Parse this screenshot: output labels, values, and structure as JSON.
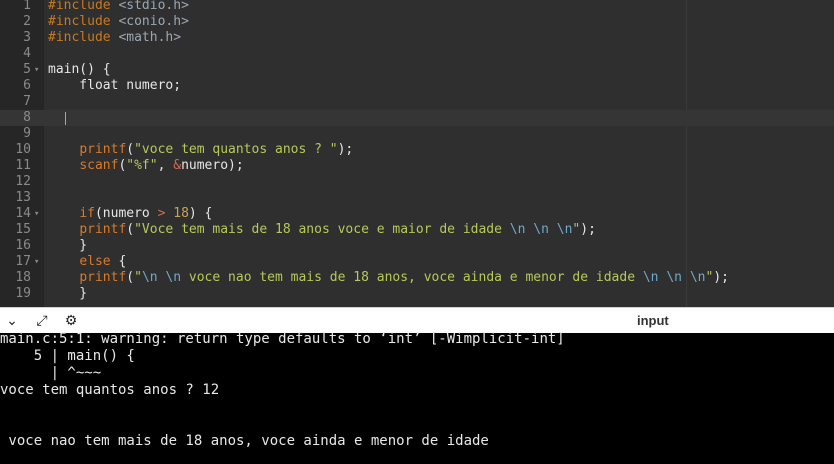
{
  "editor": {
    "lines": [
      {
        "n": "1",
        "tokens": [
          {
            "t": "#include ",
            "c": "t-pre"
          },
          {
            "t": "<stdio.h>",
            "c": "t-inc"
          }
        ]
      },
      {
        "n": "2",
        "tokens": [
          {
            "t": "#include ",
            "c": "t-pre"
          },
          {
            "t": "<conio.h>",
            "c": "t-inc"
          }
        ]
      },
      {
        "n": "3",
        "tokens": [
          {
            "t": "#include ",
            "c": "t-pre"
          },
          {
            "t": "<math.h>",
            "c": "t-inc"
          }
        ]
      },
      {
        "n": "4",
        "tokens": []
      },
      {
        "n": "5",
        "fold": true,
        "tokens": [
          {
            "t": "main() {",
            "c": ""
          }
        ]
      },
      {
        "n": "6",
        "tokens": [
          {
            "t": "    float numero;",
            "c": ""
          }
        ]
      },
      {
        "n": "7",
        "tokens": []
      },
      {
        "n": "8",
        "active": true,
        "tokens": []
      },
      {
        "n": "9",
        "tokens": []
      },
      {
        "n": "10",
        "tokens": [
          {
            "t": "    ",
            "c": ""
          },
          {
            "t": "printf",
            "c": "t-fn"
          },
          {
            "t": "(",
            "c": ""
          },
          {
            "t": "\"voce tem quantos anos ? \"",
            "c": "t-str"
          },
          {
            "t": ");",
            "c": ""
          }
        ]
      },
      {
        "n": "11",
        "tokens": [
          {
            "t": "    ",
            "c": ""
          },
          {
            "t": "scanf",
            "c": "t-fn"
          },
          {
            "t": "(",
            "c": ""
          },
          {
            "t": "\"%f\"",
            "c": "t-str"
          },
          {
            "t": ", ",
            "c": ""
          },
          {
            "t": "&",
            "c": "t-op"
          },
          {
            "t": "numero);",
            "c": ""
          }
        ]
      },
      {
        "n": "12",
        "tokens": []
      },
      {
        "n": "13",
        "tokens": []
      },
      {
        "n": "14",
        "fold": true,
        "tokens": [
          {
            "t": "    ",
            "c": ""
          },
          {
            "t": "if",
            "c": "t-kw"
          },
          {
            "t": "(numero ",
            "c": ""
          },
          {
            "t": ">",
            "c": "t-op"
          },
          {
            "t": " ",
            "c": ""
          },
          {
            "t": "18",
            "c": "t-num"
          },
          {
            "t": ") {",
            "c": ""
          }
        ]
      },
      {
        "n": "15",
        "tokens": [
          {
            "t": "    ",
            "c": ""
          },
          {
            "t": "printf",
            "c": "t-fn"
          },
          {
            "t": "(",
            "c": ""
          },
          {
            "t": "\"Voce tem mais de 18 anos voce e maior de idade ",
            "c": "t-str"
          },
          {
            "t": "\\n",
            "c": "t-esc"
          },
          {
            "t": " ",
            "c": "t-str"
          },
          {
            "t": "\\n",
            "c": "t-esc"
          },
          {
            "t": " ",
            "c": "t-str"
          },
          {
            "t": "\\n",
            "c": "t-esc"
          },
          {
            "t": "\"",
            "c": "t-str"
          },
          {
            "t": ");",
            "c": ""
          }
        ]
      },
      {
        "n": "16",
        "tokens": [
          {
            "t": "    }",
            "c": ""
          }
        ]
      },
      {
        "n": "17",
        "fold": true,
        "tokens": [
          {
            "t": "    ",
            "c": ""
          },
          {
            "t": "else",
            "c": "t-kw"
          },
          {
            "t": " {",
            "c": ""
          }
        ]
      },
      {
        "n": "18",
        "tokens": [
          {
            "t": "    ",
            "c": ""
          },
          {
            "t": "printf",
            "c": "t-fn"
          },
          {
            "t": "(",
            "c": ""
          },
          {
            "t": "\"",
            "c": "t-str"
          },
          {
            "t": "\\n",
            "c": "t-esc"
          },
          {
            "t": " ",
            "c": "t-str"
          },
          {
            "t": "\\n",
            "c": "t-esc"
          },
          {
            "t": " voce nao tem mais de 18 anos, voce ainda e menor de idade ",
            "c": "t-str"
          },
          {
            "t": "\\n",
            "c": "t-esc"
          },
          {
            "t": " ",
            "c": "t-str"
          },
          {
            "t": "\\n",
            "c": "t-esc"
          },
          {
            "t": " ",
            "c": "t-str"
          },
          {
            "t": "\\n",
            "c": "t-esc"
          },
          {
            "t": "\"",
            "c": "t-str"
          },
          {
            "t": ");",
            "c": ""
          }
        ]
      },
      {
        "n": "19",
        "tokens": [
          {
            "t": "    }",
            "c": ""
          }
        ]
      }
    ]
  },
  "panel": {
    "label": "input",
    "icons": [
      "chevron-down-icon",
      "expand-icon",
      "settings-icon"
    ]
  },
  "console": {
    "lines": [
      "main.c:5:1: warning: return type defaults to ‘int’ [-Wimplicit-int]",
      "    5 | main() {",
      "      | ^~~~",
      "voce tem quantos anos ? 12",
      "",
      "",
      " voce nao tem mais de 18 anos, voce ainda e menor de idade"
    ]
  }
}
